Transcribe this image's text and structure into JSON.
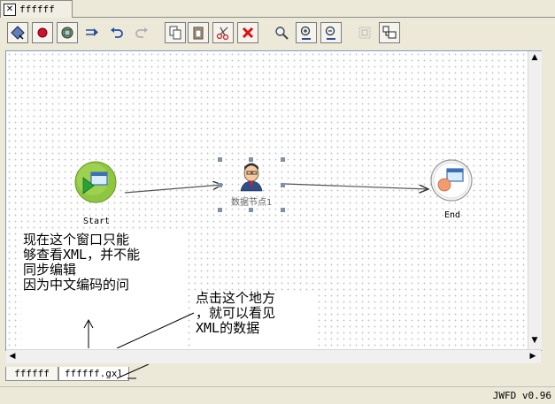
{
  "window": {
    "tab_title": "ffffff"
  },
  "toolbar": {
    "buttons": [
      {
        "name": "select-tool-icon"
      },
      {
        "name": "record-icon"
      },
      {
        "name": "node-tool-icon"
      },
      {
        "name": "transition-tool-icon"
      },
      {
        "name": "undo-icon"
      },
      {
        "name": "redo-icon"
      },
      {
        "name": "copy-icon"
      },
      {
        "name": "paste-icon"
      },
      {
        "name": "cut-icon"
      },
      {
        "name": "delete-icon"
      },
      {
        "name": "search-icon"
      },
      {
        "name": "zoom-in-icon"
      },
      {
        "name": "zoom-out-icon"
      },
      {
        "name": "fit-icon"
      },
      {
        "name": "layout-icon"
      }
    ]
  },
  "diagram": {
    "start_label": "Start",
    "task_label": "数据节点1",
    "end_label": "End"
  },
  "notes": {
    "left": "现在这个窗口只能\n够查看XML，并不能\n同步编辑\n因为中文编码的问",
    "right": "点击这个地方\n，就可以看见\nXML的数据"
  },
  "bottom_tabs": {
    "design": "ffffff",
    "xml": "ffffff.gxl"
  },
  "status": {
    "version": "JWFD v0.96"
  },
  "colors": {
    "start_green": "#8ec63f",
    "end_orange": "#f29b6e",
    "accent_blue": "#3b6fb6"
  }
}
